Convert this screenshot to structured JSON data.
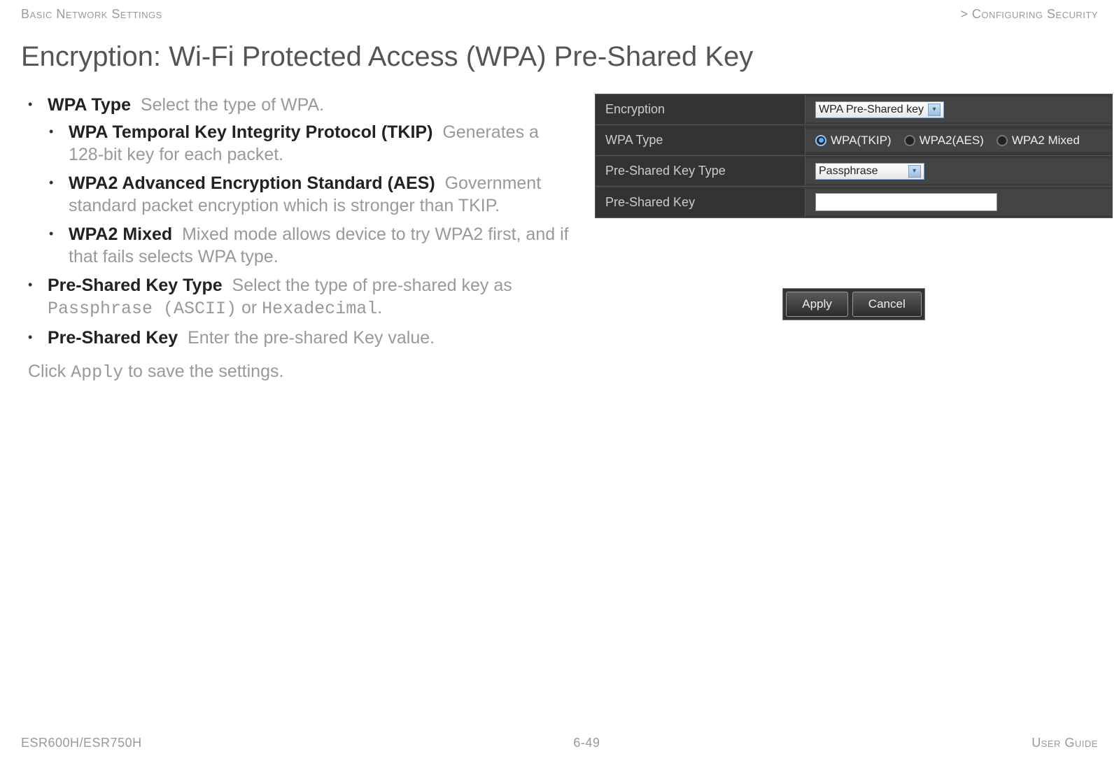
{
  "header": {
    "left": "Basic Network Settings",
    "right": "> Configuring Security"
  },
  "title": "Encryption: Wi-Fi Protected Access (WPA) Pre-Shared Key",
  "list": {
    "wpa_type": {
      "term": "WPA Type",
      "desc": "Select the type of WPA.",
      "sub": {
        "tkip": {
          "term": "WPA Temporal Key Integrity Protocol (TKIP)",
          "desc": "Generates a 128-bit key for each packet."
        },
        "aes": {
          "term": "WPA2 Advanced Encryption Standard (AES)",
          "desc": "Government standard packet encryption which is stronger than TKIP."
        },
        "mixed": {
          "term": "WPA2 Mixed",
          "desc": "Mixed mode allows device to try WPA2 first, and if that fails selects WPA type."
        }
      }
    },
    "psk_type": {
      "term": "Pre-Shared Key Type",
      "desc_pre": "Select the type of pre-shared key as ",
      "opt1": "Passphrase (ASCII)",
      "mid": " or ",
      "opt2": "Hexadecimal",
      "desc_post": "."
    },
    "psk": {
      "term": "Pre-Shared Key",
      "desc": "Enter the pre-shared Key value."
    }
  },
  "closing": {
    "pre": "Click ",
    "cmd": "Apply",
    "post": " to save the settings."
  },
  "panel": {
    "encryption": {
      "label": "Encryption",
      "value": "WPA Pre-Shared key"
    },
    "wpa_type": {
      "label": "WPA Type",
      "options": {
        "tkip": "WPA(TKIP)",
        "aes": "WPA2(AES)",
        "mixed": "WPA2 Mixed"
      }
    },
    "psk_type": {
      "label": "Pre-Shared Key Type",
      "value": "Passphrase"
    },
    "psk": {
      "label": "Pre-Shared Key"
    }
  },
  "buttons": {
    "apply": "Apply",
    "cancel": "Cancel"
  },
  "footer": {
    "left": "ESR600H/ESR750H",
    "center": "6-49",
    "right": "User Guide"
  }
}
